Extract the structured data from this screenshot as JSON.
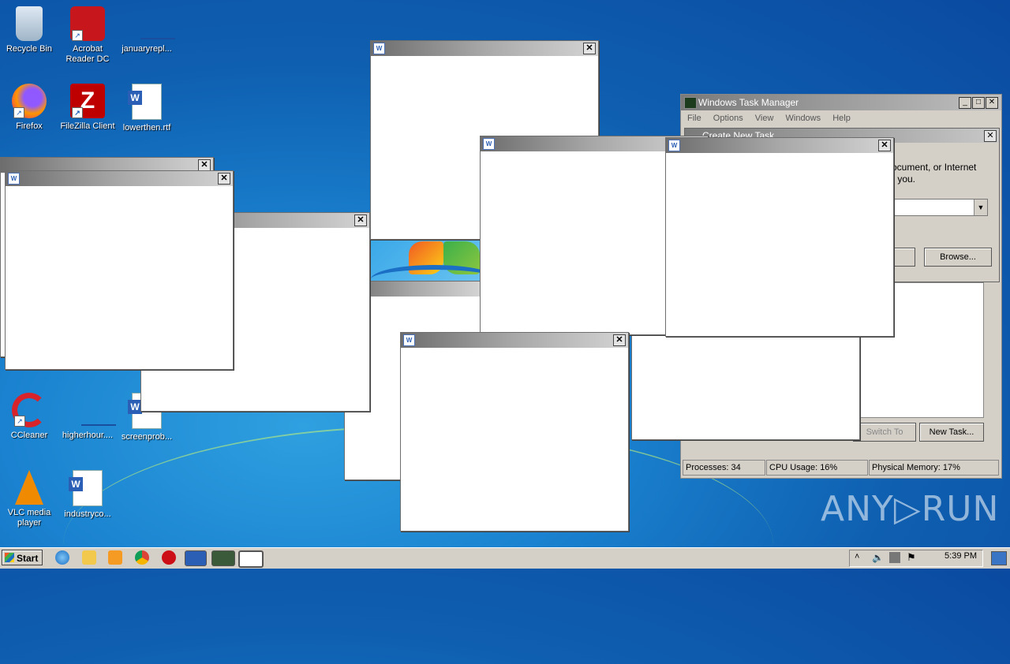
{
  "desktop": {
    "icons": [
      {
        "label": "Recycle Bin"
      },
      {
        "label": "Acrobat Reader DC"
      },
      {
        "label": "januaryrepl..."
      },
      {
        "label": "Firefox"
      },
      {
        "label": "FileZilla Client"
      },
      {
        "label": "lowerthen.rtf"
      },
      {
        "label": "CCleaner"
      },
      {
        "label": "higherhour...."
      },
      {
        "label": "screenprob..."
      },
      {
        "label": "VLC media player"
      },
      {
        "label": "industryco..."
      }
    ]
  },
  "task_manager": {
    "title": "Windows Task Manager",
    "menu": [
      "File",
      "Options",
      "View",
      "Windows",
      "Help"
    ],
    "dialog_title": "Create New Task",
    "dialog_text_1": "ocument, or Internet",
    "dialog_text_2": "r you.",
    "browse_label": "Browse...",
    "switch_to_label": "Switch To",
    "new_task_label": "New Task...",
    "processes": "Processes: 34",
    "cpu": "CPU Usage: 16%",
    "memory": "Physical Memory: 17%"
  },
  "taskbar": {
    "start_label": "Start",
    "clock": "5:39 PM"
  },
  "watermark": "ANY▷RUN"
}
